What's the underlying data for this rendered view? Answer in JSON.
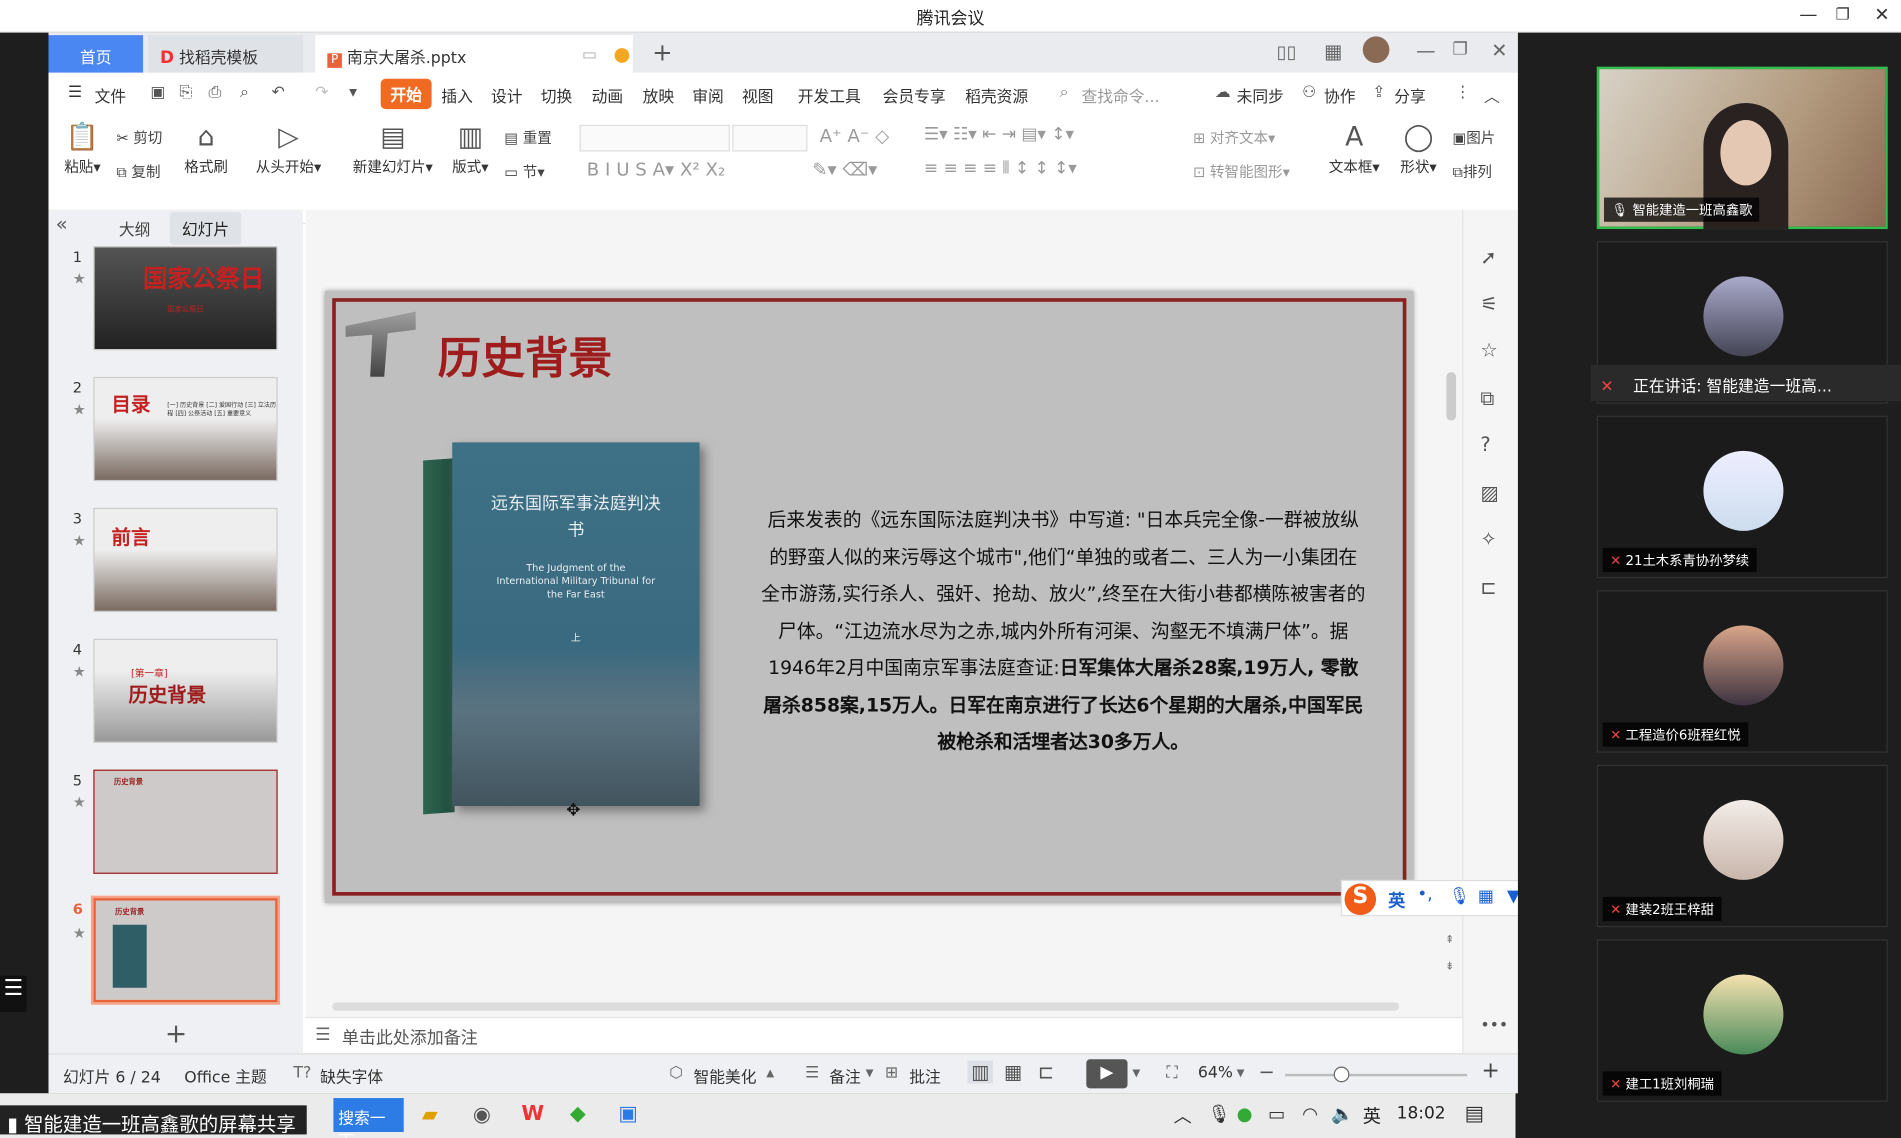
{
  "window": {
    "title": "腾讯会议"
  },
  "tabs": {
    "home": "首页",
    "template": "找稻壳模板",
    "doc": "南京大屠杀.pptx"
  },
  "menu": [
    "文件",
    "开始",
    "插入",
    "设计",
    "切换",
    "动画",
    "放映",
    "审阅",
    "视图",
    "开发工具",
    "会员专享",
    "稻壳资源"
  ],
  "menu_right": {
    "search": "查找命令...",
    "sync": "未同步",
    "collab": "协作",
    "share": "分享"
  },
  "ribbon": {
    "paste": "粘贴",
    "cut": "剪切",
    "copy": "复制",
    "format_painter": "格式刷",
    "from_start": "从头开始",
    "new_slide": "新建幻灯片",
    "layout": "版式",
    "reset": "重置",
    "section": "节",
    "align_text": "对齐文本",
    "smart_shape": "转智能图形",
    "textbox": "文本框",
    "shape": "形状",
    "picture": "图片",
    "arrange": "排列"
  },
  "panel_tabs": {
    "outline": "大纲",
    "slides": "幻灯片"
  },
  "thumbnails": [
    {
      "num": "1",
      "caption": "国家公祭日",
      "sub": "国家公祭日"
    },
    {
      "num": "2",
      "caption": "目录",
      "items": [
        "[一] 历史背景",
        "[二] 爱国行动",
        "[三] 立法历程",
        "[四] 公祭活动",
        "[五] 重要意义"
      ]
    },
    {
      "num": "3",
      "caption": "前言"
    },
    {
      "num": "4",
      "caption": "历史背景",
      "sub": "[第一章]"
    },
    {
      "num": "5",
      "caption": "历史背景"
    },
    {
      "num": "6",
      "caption": "历史背景"
    }
  ],
  "slide": {
    "title": "历史背景",
    "book": {
      "title_cn": "远东国际军事法庭判决书",
      "title_en": "The Judgment of the International Military Tribunal for the Far East",
      "vol": "上"
    },
    "body_normal": "后来发表的《远东国际法庭判决书》中写道: \"日本兵完全像-一群被放纵的野蛮人似的来污辱这个城市\",他们“单独的或者二、三人为一小集团在全市游荡,实行杀人、强奸、抢劫、放火”,终至在大街小巷都横陈被害者的尸体。“江边流水尽为之赤,城内外所有河渠、沟壑无不填满尸体”。据1946年2月中国南京军事法庭查证:",
    "body_bold": "日军集体大屠杀28案,19万人, 零散屠杀858案,15万人。日军在南京进行了长达6个星期的大屠杀,中国军民被枪杀和活埋者达30多万人。"
  },
  "notes_placeholder": "单击此处添加备注",
  "status": {
    "slide_pos": "幻灯片 6 / 24",
    "theme": "Office 主题",
    "missing_font": "缺失字体",
    "beautify": "智能美化",
    "notes": "备注",
    "comment": "批注",
    "zoom": "64%"
  },
  "zoom_value": 0.64,
  "ime": {
    "lang": "英"
  },
  "taskbar": {
    "search": "搜索一下",
    "lang": "英",
    "time": "18:02",
    "share_label": "智能建造一班高鑫歌的屏幕共享"
  },
  "participants": [
    {
      "name": "智能建造一班高鑫歌",
      "video": true
    },
    {
      "name": "正在讲话: 智能建造一班高...",
      "speaking": true
    },
    {
      "name": "21土木系青协孙梦续"
    },
    {
      "name": "工程造价6班程红悦"
    },
    {
      "name": "建装2班王梓甜"
    },
    {
      "name": "建工1班刘桐瑞"
    }
  ],
  "colors": {
    "accent": "#4a87f2",
    "slide_title": "#9e1c1c",
    "frame": "#8b2020",
    "selected_thumb": "#e8633a",
    "start_tab": "#f06a22"
  }
}
